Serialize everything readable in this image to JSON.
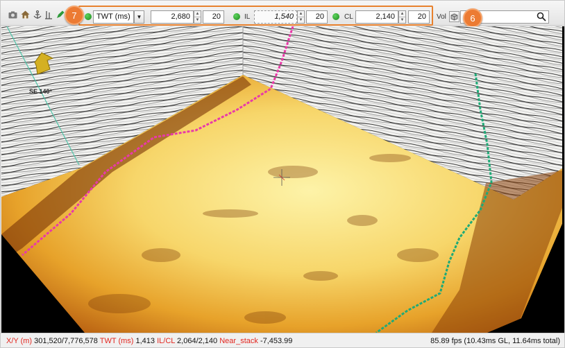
{
  "toolbar": {
    "domain_select": "TWT (ms)",
    "time_value": "2,680",
    "time_step": "20",
    "il_label": "IL",
    "il_value": "1,540",
    "il_step": "20",
    "cl_label": "CL",
    "cl_value": "2,140",
    "cl_step": "20",
    "vol_label": "Vol",
    "search_value": ""
  },
  "callouts": {
    "left_badge": "7",
    "right_badge": "6"
  },
  "viewport": {
    "compass_label": "SE 140°"
  },
  "status": {
    "xy_label": "X/Y (m)",
    "xy_value": "301,520/7,776,578",
    "twt_label": "TWT (ms)",
    "twt_value": "1,413",
    "ilcl_label": "IL/CL",
    "ilcl_value": "2,064/2,140",
    "attr_label": "Near_stack",
    "attr_value": "-7,453.99",
    "perf": "85.89 fps (10.43ms GL, 11.64ms total)"
  },
  "colors": {
    "accent": "#e8812d",
    "well_pink": "#e83aa8",
    "well_green": "#1faa77",
    "status_label": "#e3261f"
  }
}
